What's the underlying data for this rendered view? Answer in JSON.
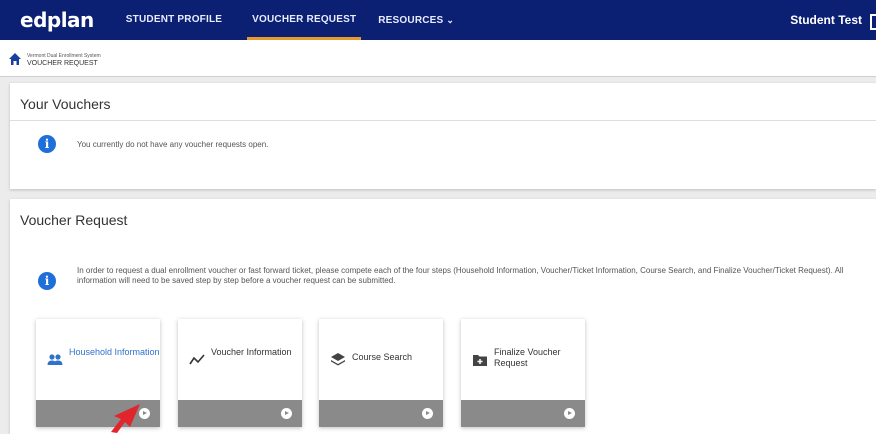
{
  "nav": {
    "logo": "edplan",
    "items": [
      "STUDENT PROFILE",
      "VOUCHER REQUEST",
      "RESOURCES"
    ],
    "user": "Student Test"
  },
  "breadcrumb": {
    "system": "Vermont Dual Enrollment System",
    "current": "VOUCHER REQUEST"
  },
  "vouchers": {
    "title": "Your Vouchers",
    "message": "You currently do not have any voucher requests open."
  },
  "request": {
    "title": "Voucher Request",
    "message": "In order to request a dual enrollment voucher or fast forward ticket, please compete each of the four steps (Household Information, Voucher/Ticket Information, Course Search, and Finalize Voucher/Ticket Request). All information will need to be saved step by step before a voucher request can be submitted.",
    "steps": [
      {
        "label": "Household Information",
        "icon": "people-icon"
      },
      {
        "label": "Voucher Information",
        "icon": "trend-line-icon"
      },
      {
        "label": "Course Search",
        "icon": "layers-icon"
      },
      {
        "label": "Finalize Voucher Request",
        "icon": "folder-plus-icon"
      }
    ]
  },
  "colors": {
    "nav_bg": "#0b1f73",
    "accent": "#e49a2e",
    "info_blue": "#1e6fd9",
    "card_footer": "#8a8a8a",
    "pointer": "#e0262c"
  }
}
